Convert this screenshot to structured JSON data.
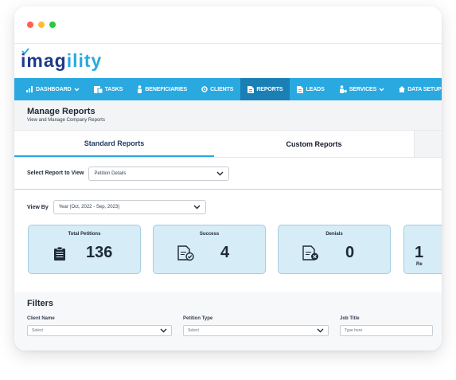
{
  "window": {
    "controls": [
      "close",
      "minimize",
      "maximize"
    ],
    "colors": {
      "close": "#ff5f57",
      "minimize": "#febc2e",
      "maximize": "#28c840"
    }
  },
  "brand": {
    "name_part1": "imag",
    "name_part2": "ility",
    "primary": "#1e3a8a",
    "accent": "#29a9e0"
  },
  "nav": {
    "items": [
      {
        "label": "DASHBOARD",
        "icon": "bar-chart-icon",
        "chevron": true
      },
      {
        "label": "TASKS",
        "icon": "tasks-icon",
        "chevron": false
      },
      {
        "label": "BENEFICIARIES",
        "icon": "person-icon",
        "chevron": false
      },
      {
        "label": "CLIENTS",
        "icon": "gear-icon",
        "chevron": false
      },
      {
        "label": "REPORTS",
        "icon": "document-icon",
        "chevron": false,
        "active": true
      },
      {
        "label": "LEADS",
        "icon": "document-icon",
        "chevron": false
      },
      {
        "label": "SERVICES",
        "icon": "person-gear-icon",
        "chevron": true
      },
      {
        "label": "DATA SETUP",
        "icon": "home-icon",
        "chevron": true
      }
    ]
  },
  "page": {
    "title": "Manage Reports",
    "subtitle": "View and Manage Company Reports"
  },
  "tabs": [
    {
      "label": "Standard Reports",
      "active": true
    },
    {
      "label": "Custom Reports",
      "active": false
    }
  ],
  "report_select": {
    "label": "Select Report to View",
    "value": "Petition Details"
  },
  "view_by": {
    "label": "View By",
    "value": "Year (Oct, 2022 - Sep, 2023)"
  },
  "cards": [
    {
      "label": "Total Petitions",
      "value": "136",
      "icon": "clipboard-icon"
    },
    {
      "label": "Success",
      "value": "4",
      "icon": "doc-check-icon"
    },
    {
      "label": "Denials",
      "value": "0",
      "icon": "doc-x-icon"
    },
    {
      "value": "1",
      "sub": "Re"
    }
  ],
  "filters": {
    "title": "Filters",
    "client_name": {
      "label": "Client Name",
      "placeholder": "Select"
    },
    "petition_type": {
      "label": "Petition Type",
      "placeholder": "Select"
    },
    "job_title": {
      "label": "Job Title",
      "placeholder": "Type here"
    }
  }
}
